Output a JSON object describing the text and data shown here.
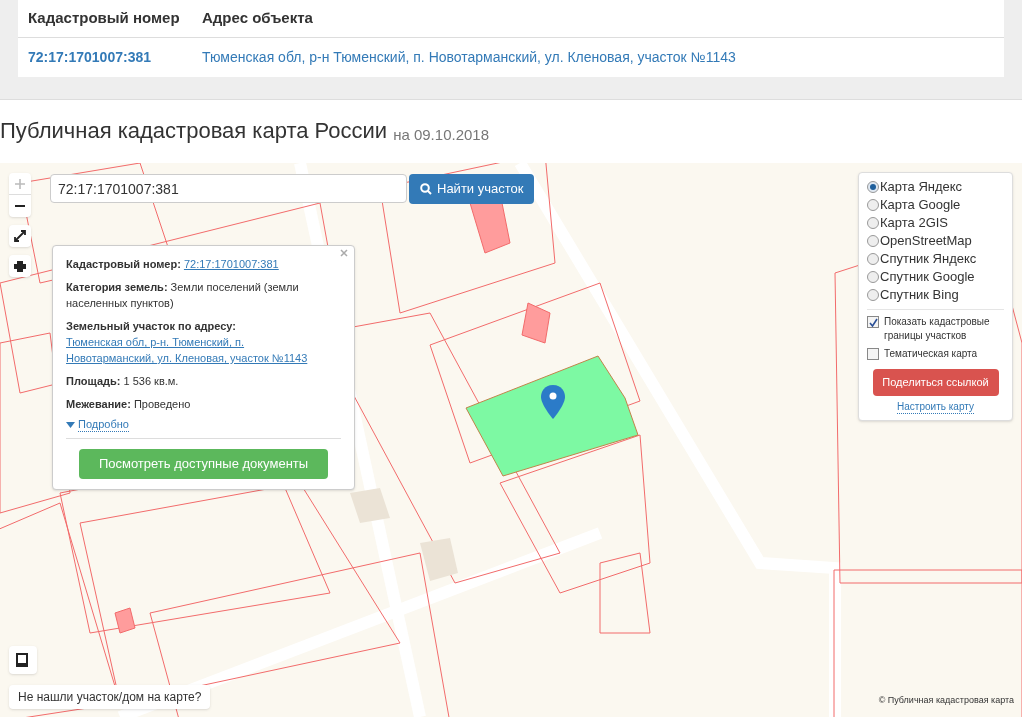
{
  "table": {
    "columns": [
      "Кадастровый номер",
      "Адрес объекта"
    ],
    "rows": [
      {
        "cells": [
          "72:17:1701007:381",
          "Тюменская обл, р-н Тюменский, п. Новотарманский, ул. Кленовая, участок №1143"
        ]
      }
    ]
  },
  "title": "Публичная кадастровая карта России",
  "title_date": "на 09.10.2018",
  "map": {
    "search": {
      "value": "72:17:1701007:381"
    },
    "search_button": "Найти участок",
    "popup": {
      "fields": [
        {
          "label": "Кадастровый номер:",
          "value": "72:17:1701007:381",
          "kind": "link"
        },
        {
          "label": "Категория земель:",
          "value": "Земли поселений (земли населенных пунктов)",
          "kind": "text"
        },
        {
          "label": "Земельный участок по адресу:",
          "value": "Тюменская обл, р-н. Тюменский, п. Новотарманский, ул. Кленовая, участок №1143",
          "kind": "link"
        },
        {
          "label": "Площадь:",
          "value": "1 536 кв.м.",
          "kind": "text"
        },
        {
          "label": "Межевание:",
          "value": "Проведено",
          "kind": "text"
        }
      ],
      "more_link": "Подробно",
      "button": "Посмотреть доступные документы"
    },
    "layers": [
      {
        "label": "Карта Яндекс",
        "selected": true
      },
      {
        "label": "Карта Google",
        "selected": false
      },
      {
        "label": "Карта 2GIS",
        "selected": false
      },
      {
        "label": "OpenStreetMap",
        "selected": false
      },
      {
        "label": "Спутник Яндекс",
        "selected": false
      },
      {
        "label": "Спутник Google",
        "selected": false
      },
      {
        "label": "Спутник Bing",
        "selected": false
      }
    ],
    "options": [
      {
        "label": "Показать кадастровые границы участков",
        "checked": true
      },
      {
        "label": "Тематическая карта",
        "checked": false
      }
    ],
    "share_button": "Поделиться ссылкой",
    "settings_link": "Настроить карту",
    "not_found_button": "Не нашли участок/дом на карте?",
    "attribution": "© Публичная кадастровая карта"
  }
}
